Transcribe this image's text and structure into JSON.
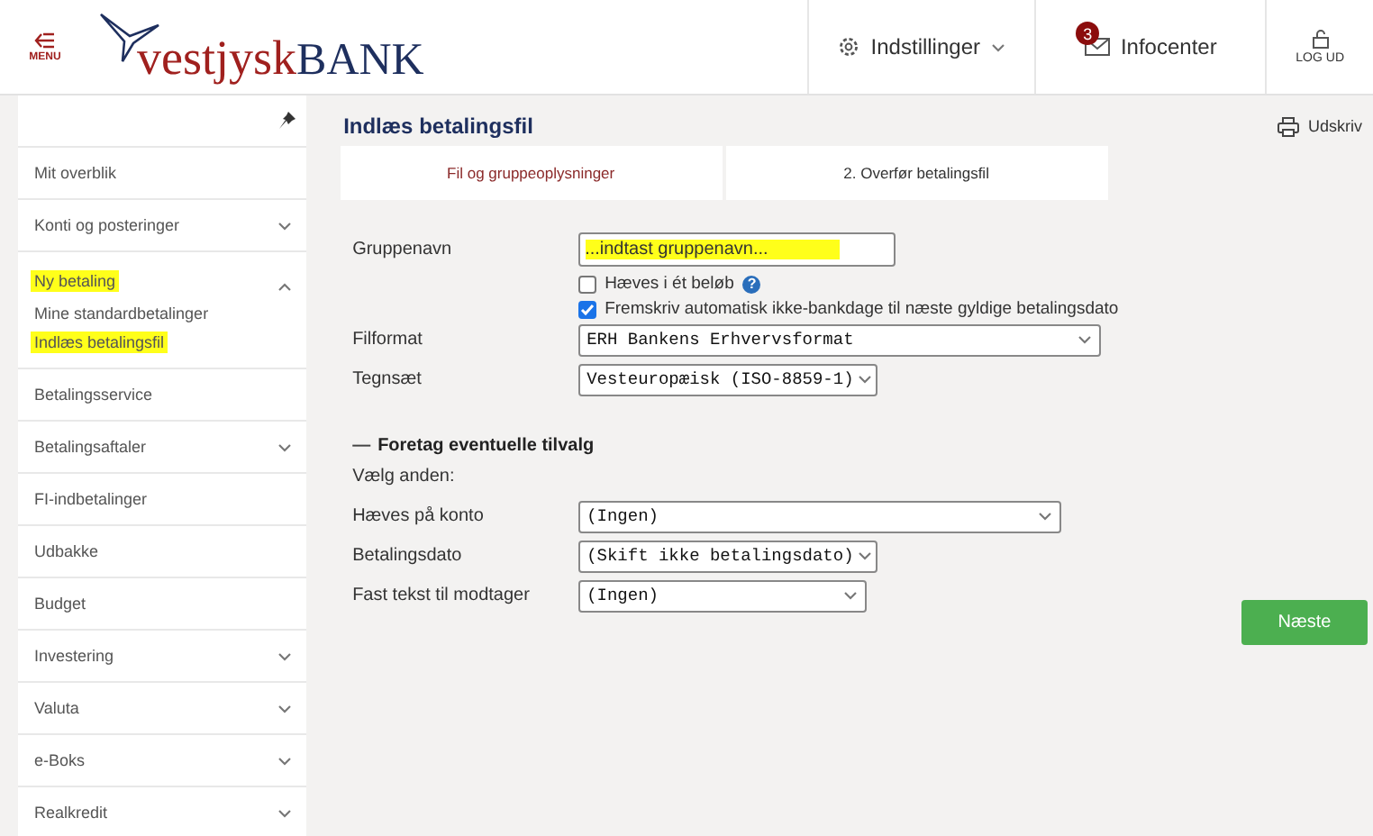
{
  "header": {
    "menu_label": "MENU",
    "logo_left": "vestjysk",
    "logo_right": "BANK",
    "settings": "Indstillinger",
    "infocenter": "Infocenter",
    "infocenter_badge": "3",
    "logout": "LOG UD"
  },
  "sidebar": {
    "items": [
      {
        "label": "Mit overblik",
        "expandable": false,
        "expanded": false,
        "highlighted": false
      },
      {
        "label": "Konti og posteringer",
        "expandable": true,
        "expanded": false,
        "highlighted": false
      },
      {
        "label": "Ny betaling",
        "expandable": true,
        "expanded": true,
        "highlighted": true,
        "children": [
          {
            "label": "Mine standardbetalinger",
            "highlighted": false
          },
          {
            "label": "Indlæs betalingsfil",
            "highlighted": true
          }
        ]
      },
      {
        "label": "Betalingsservice",
        "expandable": false,
        "expanded": false,
        "highlighted": false
      },
      {
        "label": "Betalingsaftaler",
        "expandable": true,
        "expanded": false,
        "highlighted": false
      },
      {
        "label": "FI-indbetalinger",
        "expandable": false,
        "expanded": false,
        "highlighted": false
      },
      {
        "label": "Udbakke",
        "expandable": false,
        "expanded": false,
        "highlighted": false
      },
      {
        "label": "Budget",
        "expandable": false,
        "expanded": false,
        "highlighted": false
      },
      {
        "label": "Investering",
        "expandable": true,
        "expanded": false,
        "highlighted": false
      },
      {
        "label": "Valuta",
        "expandable": true,
        "expanded": false,
        "highlighted": false
      },
      {
        "label": "e-Boks",
        "expandable": true,
        "expanded": false,
        "highlighted": false
      },
      {
        "label": "Realkredit",
        "expandable": true,
        "expanded": false,
        "highlighted": false
      }
    ]
  },
  "page": {
    "title": "Indlæs betalingsfil",
    "print": "Udskriv",
    "tabs": [
      {
        "label": "Fil og gruppeoplysninger",
        "selected": true
      },
      {
        "label": "2. Overfør betalingsfil",
        "selected": false
      }
    ],
    "group_name": {
      "label": "Gruppenavn",
      "value": "...indtast gruppenavn...",
      "highlighted": true
    },
    "checkboxes": [
      {
        "label": "Hæves i ét beløb",
        "checked": false,
        "help": "?"
      },
      {
        "label": "Fremskriv automatisk ikke-bankdage til næste gyldige betalingsdato",
        "checked": true
      }
    ],
    "selects": [
      {
        "label": "Filformat",
        "value": "ERH Bankens Erhvervsformat"
      },
      {
        "label": "Tegnsæt",
        "value": "Vesteuropæisk (ISO-8859-1)"
      }
    ],
    "options_section": {
      "toggle": "—",
      "title": "Foretag eventuelle tilvalg",
      "subtitle": "Vælg anden:",
      "selects": [
        {
          "label": "Hæves på konto",
          "value": "(Ingen)"
        },
        {
          "label": "Betalingsdato",
          "value": "(Skift ikke betalingsdato)"
        },
        {
          "label": "Fast tekst til modtager",
          "value": "(Ingen)"
        }
      ]
    },
    "next_button": "Næste"
  }
}
